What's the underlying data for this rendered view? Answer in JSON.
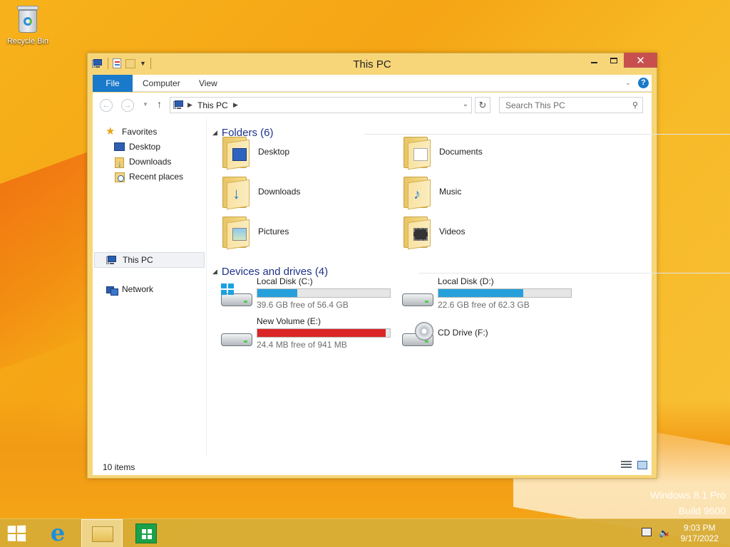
{
  "desktop": {
    "recycle_bin_label": "Recycle Bin",
    "watermark_line1": "Windows 8.1 Pro",
    "watermark_line2": "Build 9600"
  },
  "window": {
    "title": "This PC",
    "close_glyph": "✕",
    "ribbon_tabs": [
      "File",
      "Computer",
      "View"
    ],
    "help_glyph": "?"
  },
  "address": {
    "crumb": "This PC",
    "search_placeholder": "Search This PC"
  },
  "nav_pane": {
    "favorites": "Favorites",
    "desktop": "Desktop",
    "downloads": "Downloads",
    "recent_places": "Recent places",
    "this_pc": "This PC",
    "network": "Network"
  },
  "content": {
    "folders_header": "Folders (6)",
    "folders": [
      "Desktop",
      "Documents",
      "Downloads",
      "Music",
      "Pictures",
      "Videos"
    ],
    "devices_header": "Devices and drives (4)",
    "drives": [
      {
        "name": "Local Disk (C:)",
        "free": "39.6 GB free of 56.4 GB",
        "used_fraction": 0.3,
        "icon": "windows-drive-icon"
      },
      {
        "name": "Local Disk (D:)",
        "free": "22.6 GB free of 62.3 GB",
        "used_fraction": 0.64,
        "icon": "hard-drive-icon"
      },
      {
        "name": "New Volume (E:)",
        "free": "24.4 MB free of 941 MB",
        "used_fraction": 0.97,
        "icon": "hard-drive-icon"
      },
      {
        "name": "CD Drive (F:)",
        "icon": "cd-drive-icon"
      }
    ]
  },
  "status": {
    "item_count": "10 items"
  },
  "taskbar": {
    "time": "9:03 PM",
    "date": "9/17/2022"
  },
  "colors": {
    "accent": "#1979ca",
    "drive_bar": "#26a0da",
    "drive_bar_full": "#da2626",
    "header_text": "#1e3287"
  }
}
